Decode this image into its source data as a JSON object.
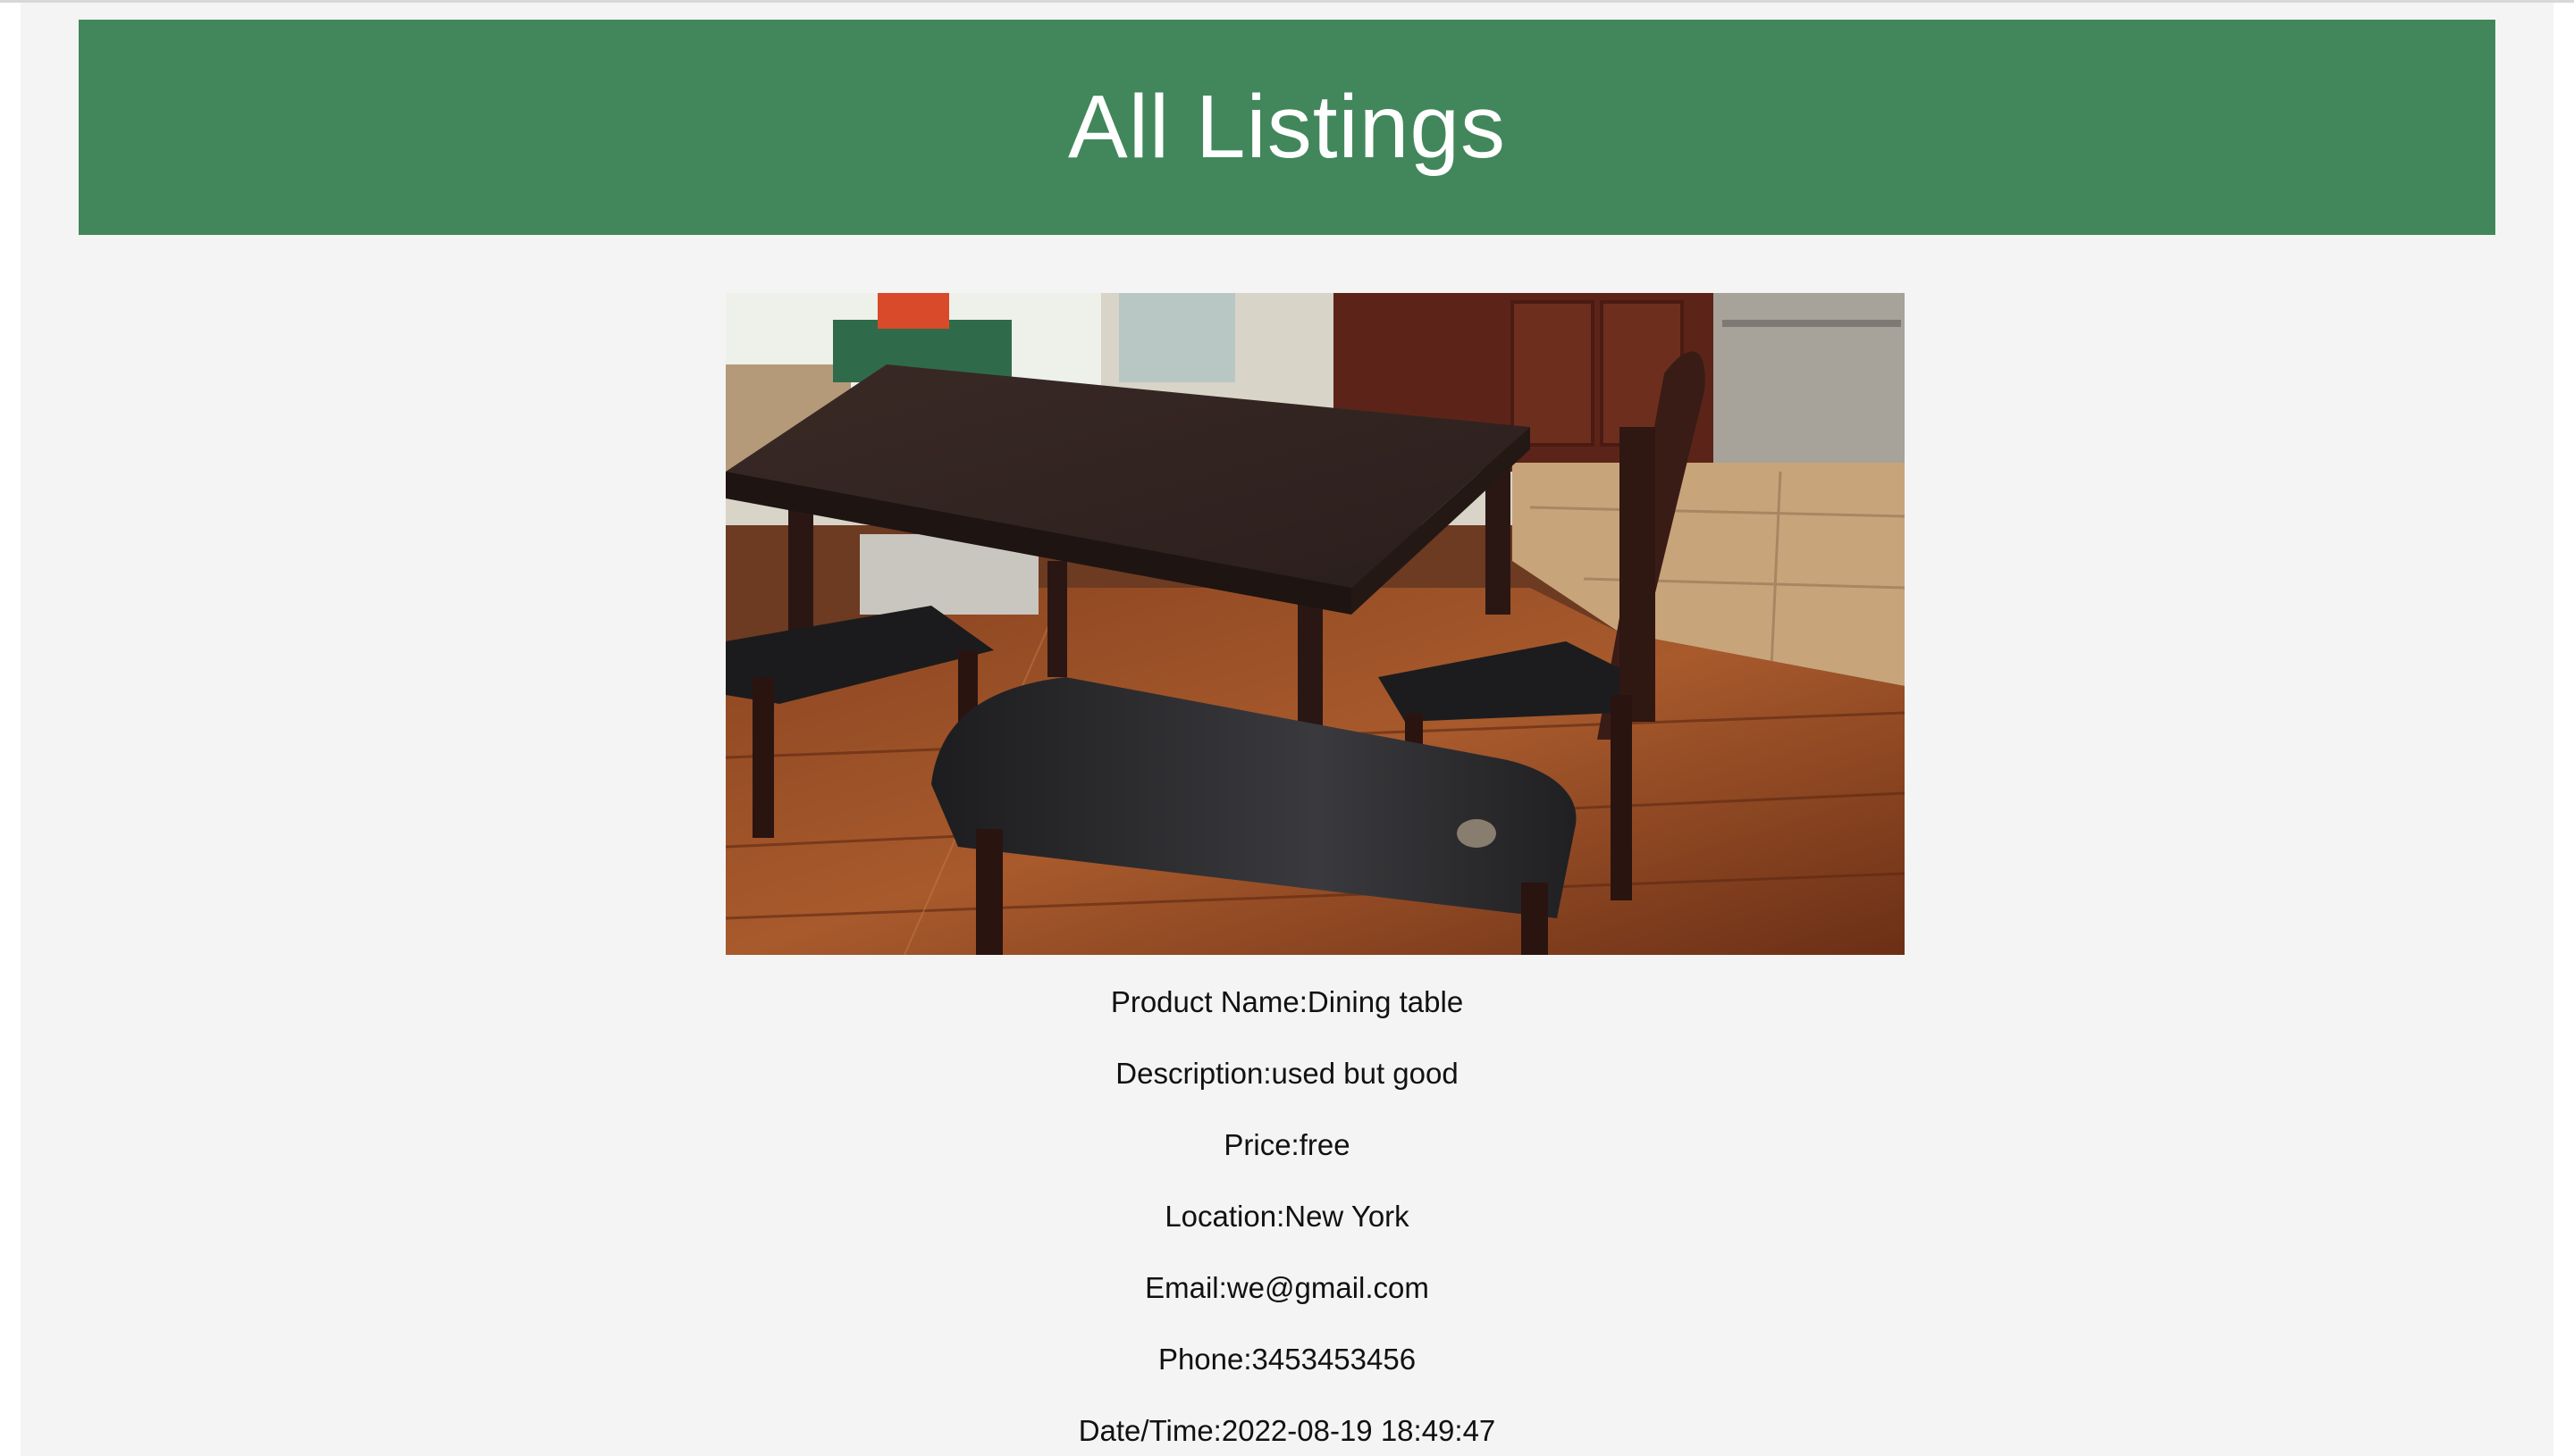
{
  "page": {
    "title": "All Listings"
  },
  "listing": {
    "image_alt": "Dining table photo",
    "fields": [
      {
        "label": "Product Name:",
        "value": "Dining table"
      },
      {
        "label": "Description:",
        "value": "used but good"
      },
      {
        "label": "Price:",
        "value": "free"
      },
      {
        "label": "Location:",
        "value": "New York"
      },
      {
        "label": "Email:",
        "value": "we@gmail.com"
      },
      {
        "label": "Phone:",
        "value": "3453453456"
      },
      {
        "label": "Date/Time:",
        "value": "2022-08-19 18:49:47"
      }
    ]
  },
  "colors": {
    "header_bg": "#41875b",
    "page_bg": "#f4f4f4"
  }
}
